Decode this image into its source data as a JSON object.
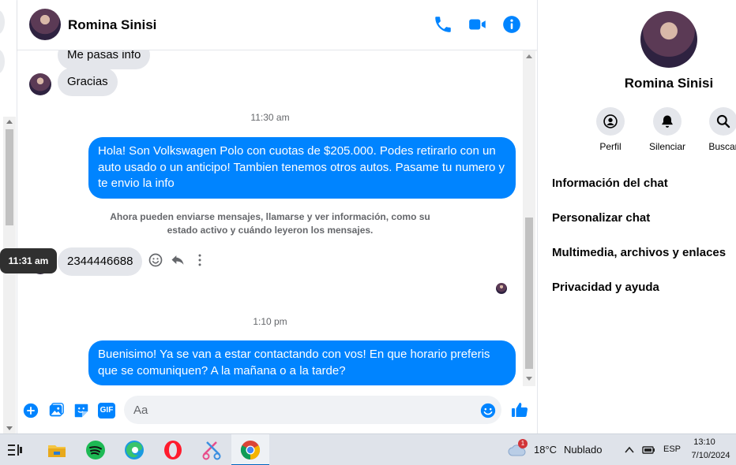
{
  "contact": {
    "name": "Romina Sinisi"
  },
  "header": {
    "call_icon": "phone-icon",
    "video_icon": "video-camera-icon",
    "info_icon": "info-icon"
  },
  "messages": {
    "m1": "Me pasas info",
    "m2": "Gracias",
    "time1": "11:30 am",
    "m3": "Hola! Son Volkswagen Polo con cuotas de $205.000. Podes retirarlo con un auto usado o un anticipo! Tambien tenemos otros autos. Pasame tu numero y te envio la info",
    "system": "Ahora pueden enviarse mensajes, llamarse y ver información, como su estado activo y cuándo leyeron los mensajes.",
    "m4": "2344446688",
    "tooltip": "11:31 am",
    "time2": "1:10 pm",
    "m5": "Buenisimo! Ya se van a estar contactando con vos! En que horario preferis que se comuniquen? A la mañana o a la tarde?"
  },
  "composer": {
    "placeholder": "Aa",
    "icons": [
      "plus-icon",
      "photo-icon",
      "sticker-icon",
      "gif-icon",
      "emoji-icon",
      "like-icon"
    ],
    "gif_label": "GIF"
  },
  "right_panel": {
    "actions": [
      {
        "label": "Perfil",
        "icon": "profile-icon"
      },
      {
        "label": "Silenciar",
        "icon": "bell-icon"
      },
      {
        "label": "Buscar",
        "icon": "search-icon"
      }
    ],
    "items": [
      "Información del chat",
      "Personalizar chat",
      "Multimedia, archivos y enlaces",
      "Privacidad y ayuda"
    ]
  },
  "taskbar": {
    "weather_temp": "18°C",
    "weather_desc": "Nublado",
    "weather_badge": "1",
    "language": "ESP",
    "time": "13:10",
    "date": "7/10/2024"
  },
  "colors": {
    "accent": "#0084ff",
    "bubble_in": "#e4e6eb",
    "secondary_text": "#65676b"
  }
}
